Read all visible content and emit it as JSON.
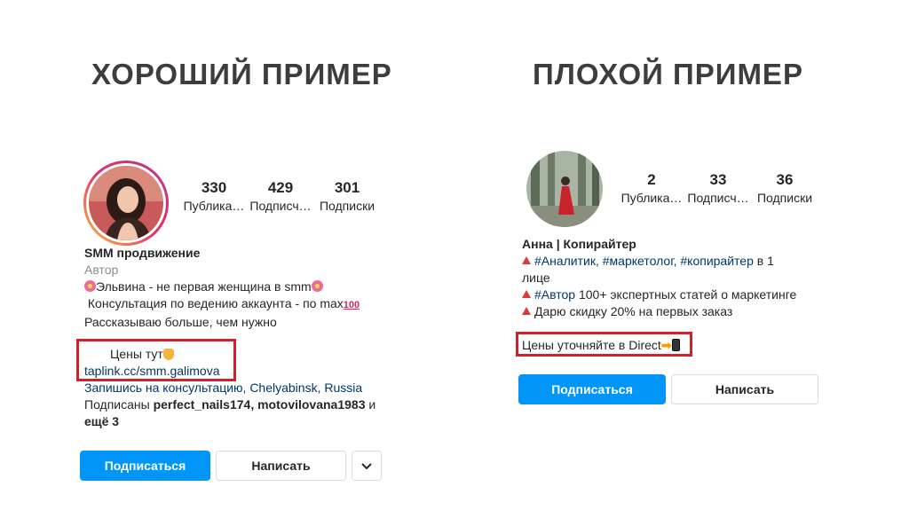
{
  "good": {
    "heading": "ХОРОШИЙ ПРИМЕР",
    "stats": [
      {
        "value": "330",
        "label": "Публика…"
      },
      {
        "value": "429",
        "label": "Подписч…"
      },
      {
        "value": "301",
        "label": "Подписки"
      }
    ],
    "name": "SMM продвижение",
    "category": "Автор",
    "bio_line1": "Эльвина - не первая женщина в smm",
    "bio_line2": "Консультация по ведению аккаунта - по max",
    "bio_line3": "Рассказываю больше, чем нужно",
    "prices": "Цены тут",
    "link": "taplink.cc/smm.galimova",
    "contact_pre": "Запишись на консультацию, ",
    "city": "Chelyabinsk",
    "comma": ", ",
    "country": "Russia",
    "followed_pre": "Подписаны ",
    "followed_users": "perfect_nails174, motovilovana1983",
    "followed_and": " и",
    "followed_more": "ещё 3",
    "subscribe": "Подписаться",
    "message": "Написать"
  },
  "bad": {
    "heading": "ПЛОХОЙ ПРИМЕР",
    "stats": [
      {
        "value": "2",
        "label": "Публика…"
      },
      {
        "value": "33",
        "label": "Подписч…"
      },
      {
        "value": "36",
        "label": "Подписки"
      }
    ],
    "name": "Анна | Копирайтер",
    "line1_tags": "#Аналитик, #маркетолог, #копирайтер",
    "line1_post": " в 1",
    "line1b": "лице",
    "line2_tag": "#Автор",
    "line2_post": " 100+ экспертных статей о маркетинге",
    "line3": "Дарю скидку 20% на первых заказ",
    "prices": "Цены уточняйте в Direct",
    "subscribe": "Подписаться",
    "message": "Написать"
  },
  "emoji": {
    "hundred": "100"
  }
}
